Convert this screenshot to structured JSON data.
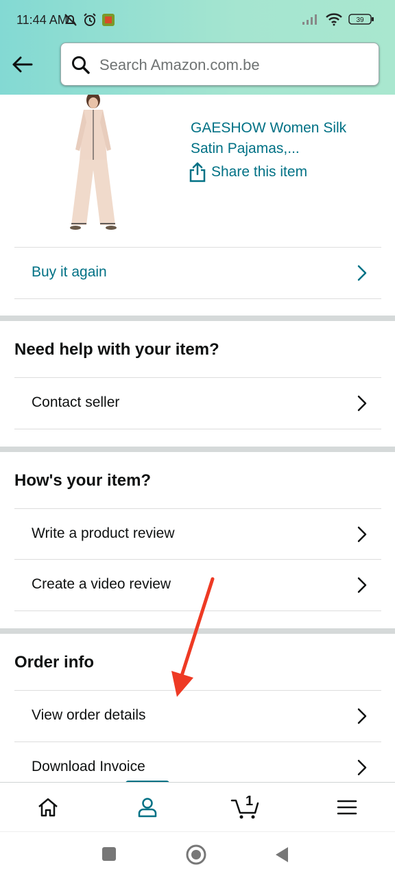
{
  "status_bar": {
    "time": "11:44 AM",
    "battery": "39",
    "icons": [
      "bell-off-icon",
      "alarm-icon",
      "app-icon",
      "signal-icon",
      "wifi-icon",
      "battery-icon"
    ]
  },
  "search": {
    "placeholder": "Search Amazon.com.be"
  },
  "product": {
    "title_line1": "GAESHOW Women Silk",
    "title_line2": "Satin Pajamas,...",
    "share_label": "Share this item"
  },
  "buy_again": {
    "label": "Buy it again"
  },
  "help_section": {
    "heading": "Need help with your item?",
    "items": [
      {
        "label": "Contact seller"
      }
    ]
  },
  "review_section": {
    "heading": "How's your item?",
    "items": [
      {
        "label": "Write a product review"
      },
      {
        "label": "Create a video review"
      }
    ]
  },
  "order_section": {
    "heading": "Order info",
    "items": [
      {
        "label": "View order details"
      },
      {
        "label": "Download Invoice"
      }
    ]
  },
  "bottom_nav": {
    "items": [
      "home-icon",
      "account-icon",
      "cart-icon",
      "menu-icon"
    ],
    "cart_count": "1",
    "active": "account-icon"
  },
  "colors": {
    "accent": "#007185",
    "header_gradient_start": "#83d9d3",
    "annotation_arrow": "#ee3a24"
  }
}
